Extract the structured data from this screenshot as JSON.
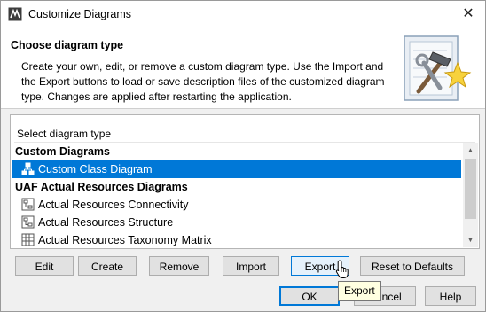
{
  "window": {
    "title": "Customize Diagrams"
  },
  "header": {
    "title": "Choose diagram type",
    "description": "Create your own, edit, or remove a custom diagram type. Use the Import and the Export buttons to load or save description files of the customized diagram type. Changes are applied after restarting the application."
  },
  "list": {
    "header": "Select diagram type",
    "rows": [
      {
        "kind": "group",
        "label": "Custom Diagrams"
      },
      {
        "kind": "item",
        "label": "Custom Class Diagram",
        "icon": "class-diagram-icon",
        "selected": true
      },
      {
        "kind": "group",
        "label": "UAF Actual Resources Diagrams"
      },
      {
        "kind": "item",
        "label": "Actual Resources Connectivity",
        "icon": "diagram-icon"
      },
      {
        "kind": "item",
        "label": "Actual Resources Structure",
        "icon": "diagram-icon"
      },
      {
        "kind": "item",
        "label": "Actual Resources Taxonomy Matrix",
        "icon": "matrix-icon"
      }
    ]
  },
  "actions": {
    "edit": "Edit",
    "create": "Create",
    "remove": "Remove",
    "import": "Import",
    "export": "Export",
    "reset": "Reset to Defaults"
  },
  "dialog": {
    "ok": "OK",
    "cancel": "Cancel",
    "help": "Help"
  },
  "tooltip": "Export",
  "colors": {
    "selection": "#0078d7",
    "focus_border": "#0078d7",
    "tooltip_bg": "#ffffe1"
  }
}
